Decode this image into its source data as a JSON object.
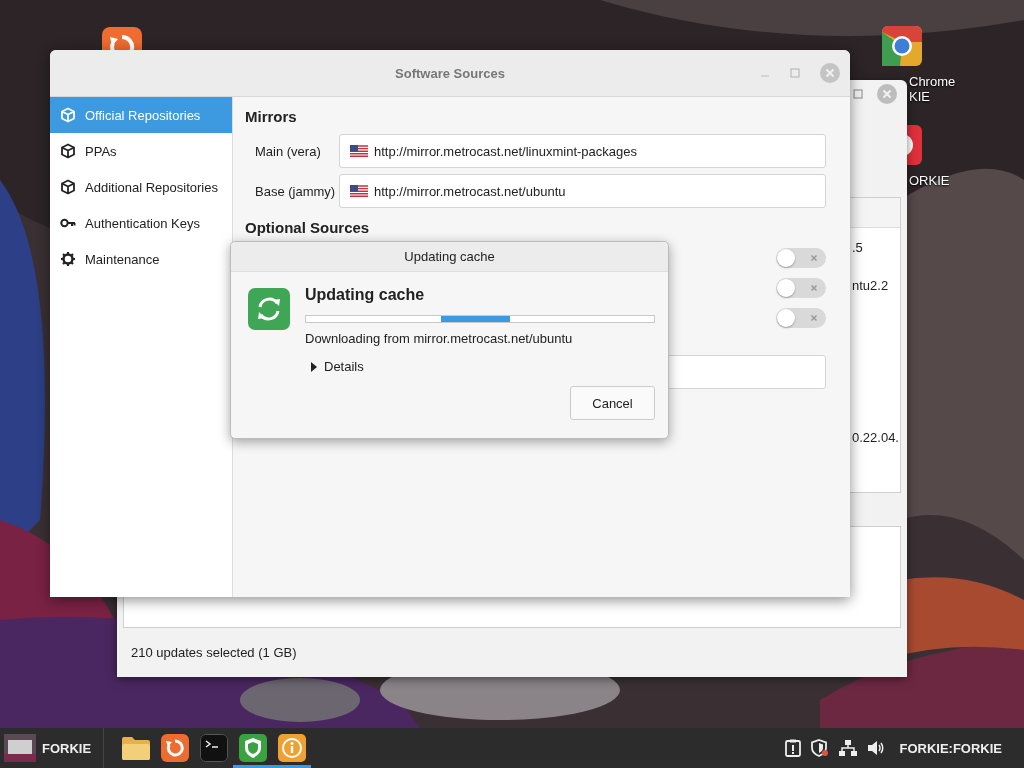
{
  "desktop_icons": [
    {
      "kind": "updater"
    },
    {
      "kind": "chrome",
      "label_lines": [
        "Chrome",
        "KIE"
      ]
    },
    {
      "kind": "red-app",
      "label_lines": [
        "ORKIE"
      ]
    }
  ],
  "background_window": {
    "list_fragments": [
      ".5",
      "ntu2.2",
      "0.22.04."
    ],
    "status_bar": "210 updates selected (1 GB)"
  },
  "window": {
    "title": "Software Sources",
    "sidebar": {
      "items": [
        {
          "label": "Official Repositories",
          "kind": "cube",
          "selected": true
        },
        {
          "label": "PPAs",
          "kind": "cube",
          "selected": false
        },
        {
          "label": "Additional Repositories",
          "kind": "cube",
          "selected": false
        },
        {
          "label": "Authentication Keys",
          "kind": "key",
          "selected": false
        },
        {
          "label": "Maintenance",
          "kind": "gear",
          "selected": false
        }
      ]
    },
    "mirrors": {
      "heading": "Mirrors",
      "rows": [
        {
          "label": "Main (vera)",
          "value": "http://mirror.metrocast.net/linuxmint-packages"
        },
        {
          "label": "Base (jammy)",
          "value": "http://mirror.metrocast.net/ubuntu"
        }
      ]
    },
    "optional_sources": {
      "heading": "Optional Sources",
      "toggles": [
        {
          "on": false
        },
        {
          "on": false
        },
        {
          "on": false
        }
      ]
    }
  },
  "dialog": {
    "title": "Updating cache",
    "heading": "Updating cache",
    "progress": {
      "indeterminate": true
    },
    "message": "Downloading from mirror.metrocast.net/ubuntu",
    "details": {
      "label": "Details",
      "expanded": false
    },
    "buttons": [
      "Cancel"
    ]
  },
  "taskbar": {
    "user": "FORKIE",
    "launchers": [
      {
        "kind": "folder",
        "running": false
      },
      {
        "kind": "updater",
        "running": false
      },
      {
        "kind": "terminal",
        "running": false
      },
      {
        "kind": "shield",
        "running": true
      },
      {
        "kind": "info",
        "running": true
      }
    ],
    "tray_label": "FORKIE:FORKIE"
  }
}
